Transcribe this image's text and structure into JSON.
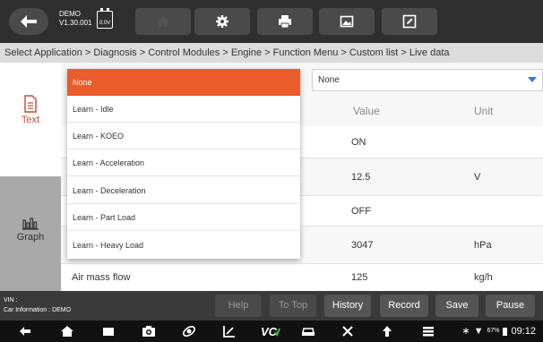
{
  "header": {
    "demo_label": "DEMO",
    "version": "V1.30.001",
    "voltage": "0.0V",
    "tools": [
      "home-icon",
      "gear-icon",
      "print-icon",
      "image-icon",
      "edit-icon"
    ]
  },
  "breadcrumb": "Select Application > Diagnosis > Control Modules > Engine > Function Menu > Custom list > Live data",
  "side": {
    "text_label": "Text",
    "graph_label": "Graph"
  },
  "filter": {
    "selected": "None"
  },
  "table": {
    "headers": {
      "value": "Value",
      "unit": "Unit"
    },
    "rows": [
      {
        "name": "",
        "value": "ON",
        "unit": ""
      },
      {
        "name": "",
        "value": "12.5",
        "unit": "V"
      },
      {
        "name": "",
        "value": "OFF",
        "unit": ""
      },
      {
        "name": "",
        "value": "3047",
        "unit": "hPa"
      },
      {
        "name": "Air mass flow",
        "value": "125",
        "unit": "kg/h"
      }
    ]
  },
  "dropdown": {
    "options": [
      "None",
      "Learn - Idle",
      "Learn - KOEO",
      "Learn - Acceleration",
      "Learn - Deceleration",
      "Learn - Part Load",
      "Learn - Heavy Load"
    ],
    "selected_index": 0,
    "selected_color": "#ea5c2c"
  },
  "vehicle": {
    "vin": "VIN :",
    "car_info": "Car Information : DEMO"
  },
  "actions": {
    "help": "Help",
    "to_top": "To Top",
    "history": "History",
    "record": "Record",
    "save": "Save",
    "pause": "Pause"
  },
  "status_bar": {
    "battery": "67%",
    "time": "09:12"
  },
  "colors": {
    "accent": "#ea5c2c",
    "toolbar": "#2f2f2f",
    "select_caret": "#2b7fe0"
  }
}
